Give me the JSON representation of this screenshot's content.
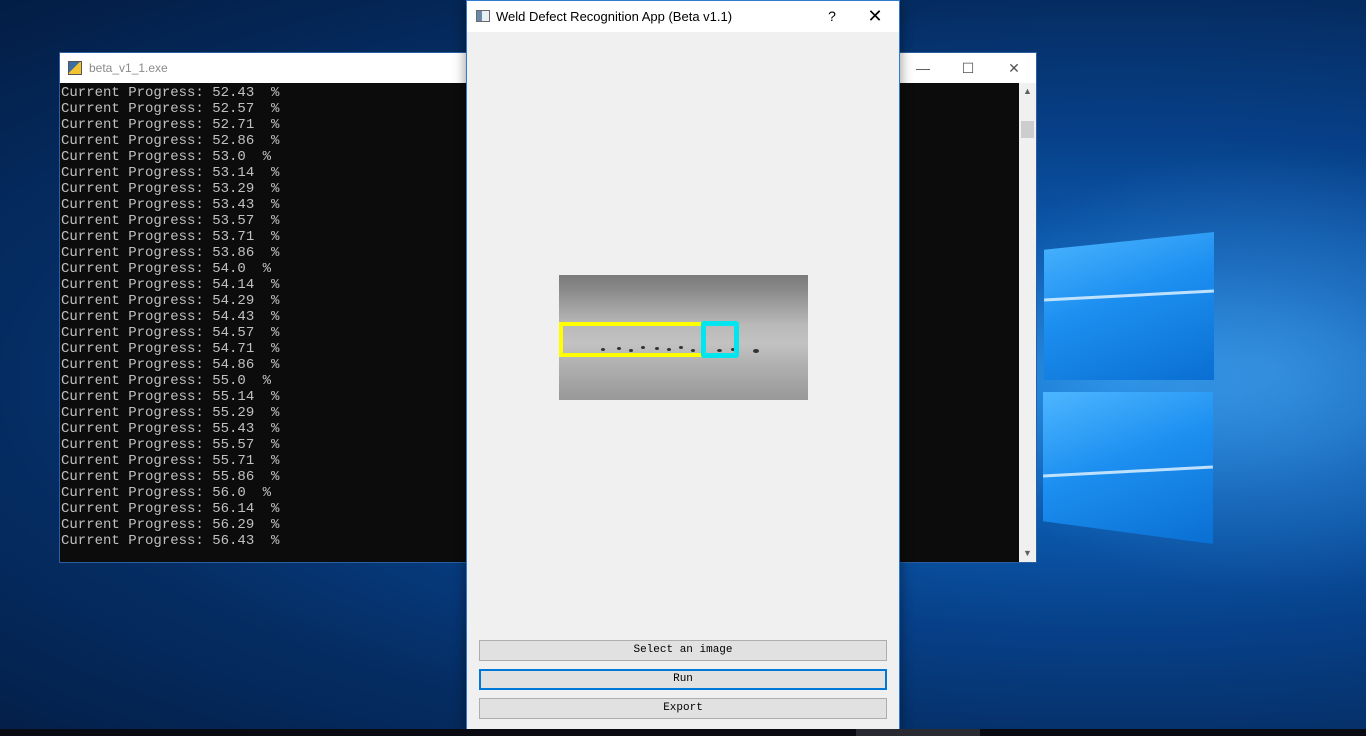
{
  "console": {
    "title": "beta_v1_1.exe",
    "minimize_icon": "minimize-icon",
    "maximize_icon": "maximize-icon",
    "close_icon": "close-icon",
    "lines": [
      "Current Progress: 52.43  %",
      "Current Progress: 52.57  %",
      "Current Progress: 52.71  %",
      "Current Progress: 52.86  %",
      "Current Progress: 53.0  %",
      "Current Progress: 53.14  %",
      "Current Progress: 53.29  %",
      "Current Progress: 53.43  %",
      "Current Progress: 53.57  %",
      "Current Progress: 53.71  %",
      "Current Progress: 53.86  %",
      "Current Progress: 54.0  %",
      "Current Progress: 54.14  %",
      "Current Progress: 54.29  %",
      "Current Progress: 54.43  %",
      "Current Progress: 54.57  %",
      "Current Progress: 54.71  %",
      "Current Progress: 54.86  %",
      "Current Progress: 55.0  %",
      "Current Progress: 55.14  %",
      "Current Progress: 55.29  %",
      "Current Progress: 55.43  %",
      "Current Progress: 55.57  %",
      "Current Progress: 55.71  %",
      "Current Progress: 55.86  %",
      "Current Progress: 56.0  %",
      "Current Progress: 56.14  %",
      "Current Progress: 56.29  %",
      "Current Progress: 56.43  %"
    ]
  },
  "app": {
    "title": "Weld Defect Recognition App (Beta v1.1)",
    "help_label": "?",
    "close_label": "✕",
    "image": {
      "description_icon": "weld-radiograph-image",
      "box_colors": {
        "yellow": "#ffff00",
        "cyan": "#00e5ee"
      }
    },
    "buttons": {
      "select_image": "Select an image",
      "run": "Run",
      "export": "Export"
    }
  },
  "colors": {
    "accent": "#0078d7",
    "console_bg": "#0c0c0c",
    "console_text": "#c0c0c0",
    "dialog_bg": "#f0f0f0"
  }
}
